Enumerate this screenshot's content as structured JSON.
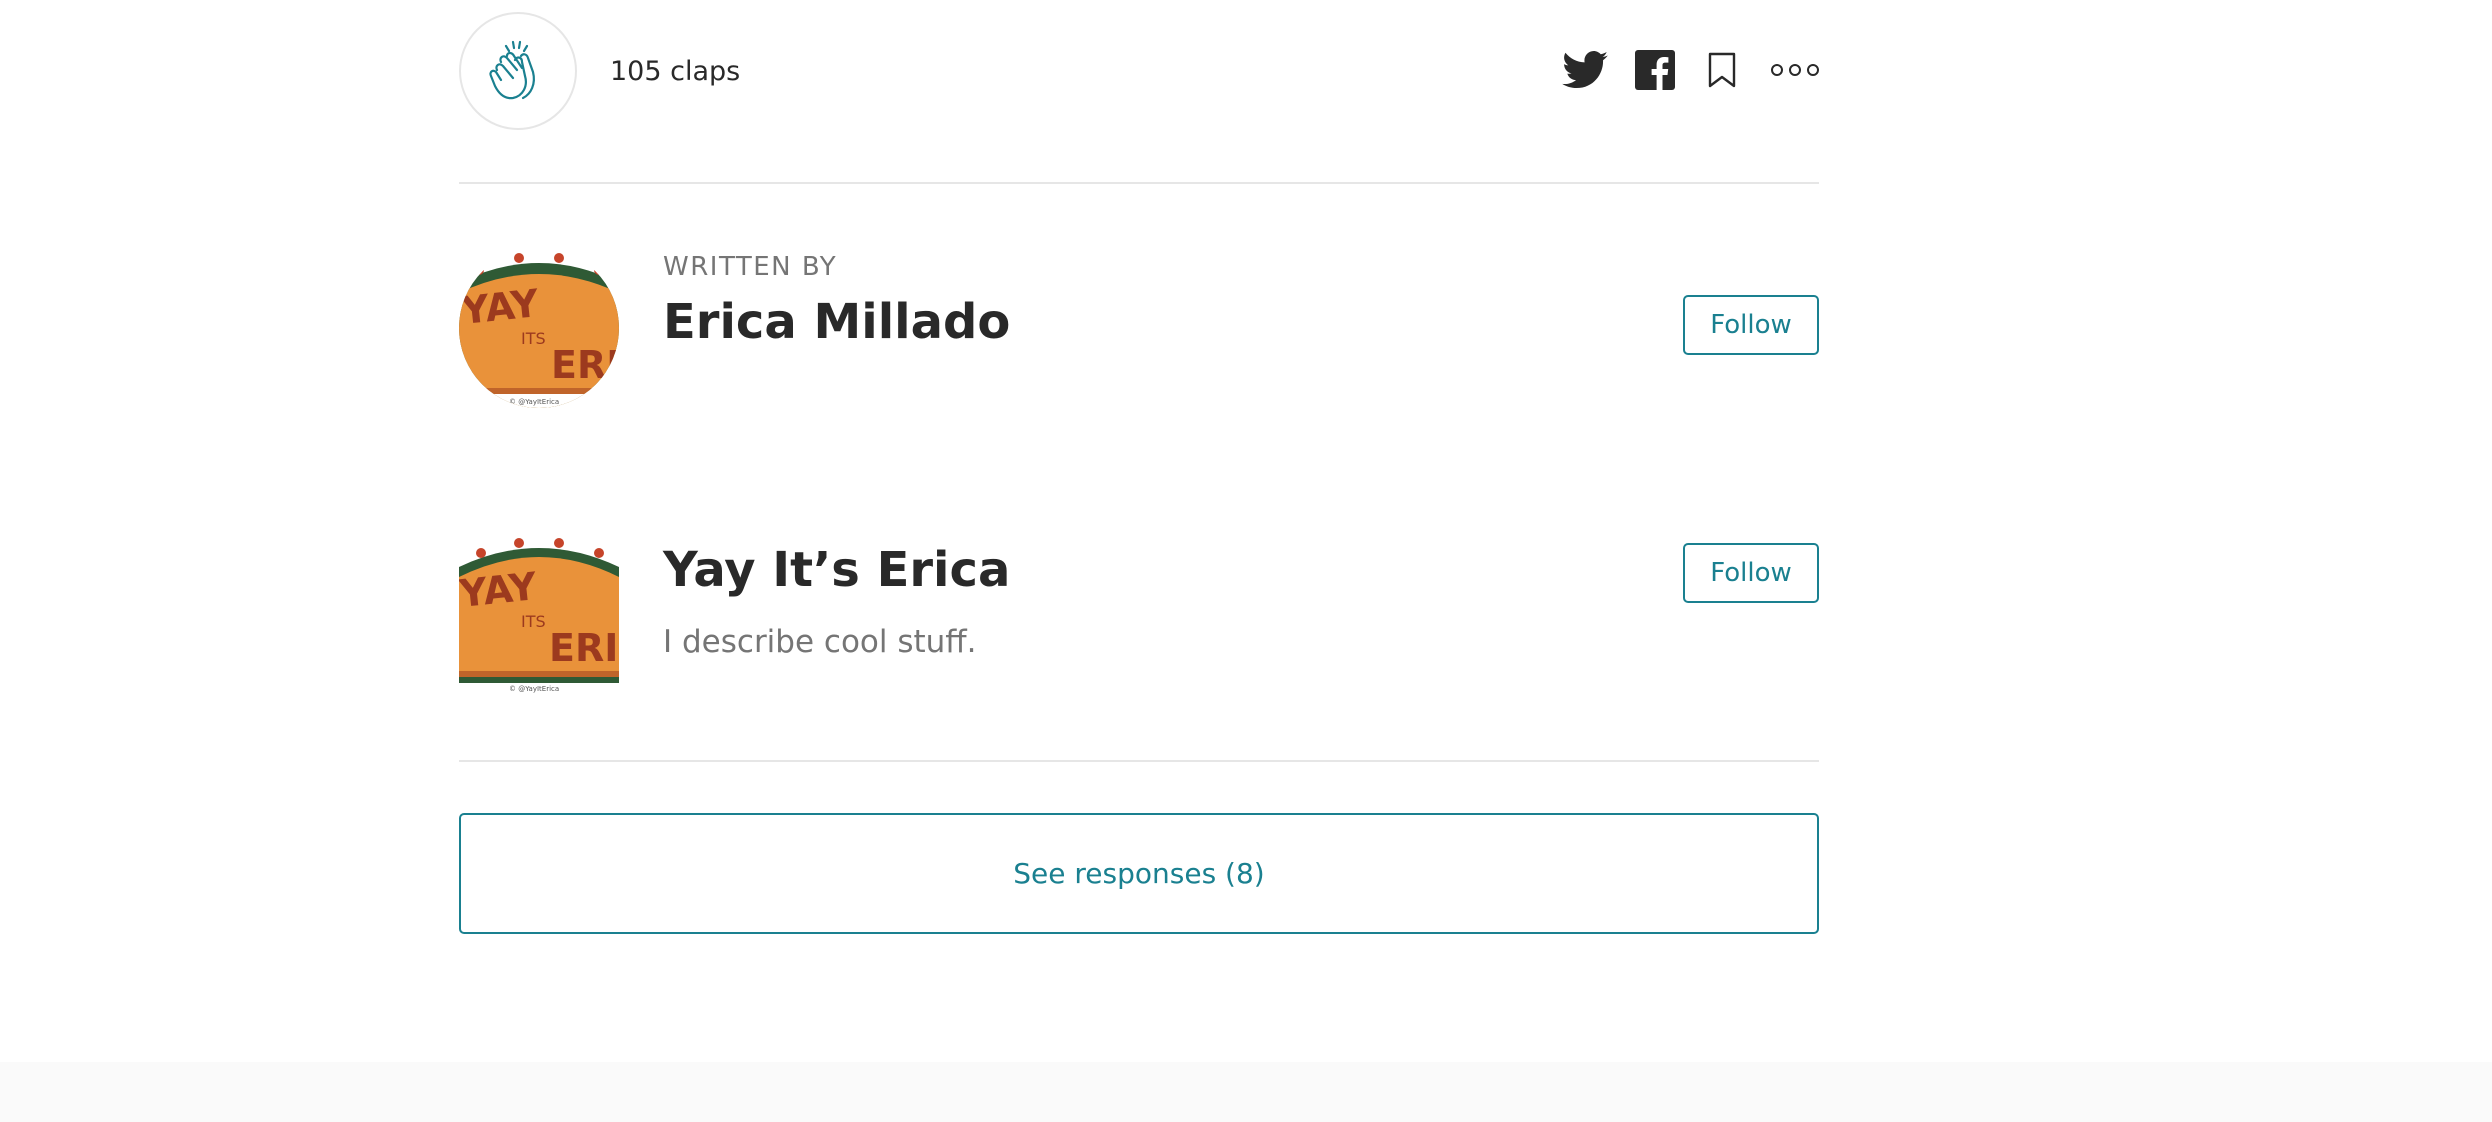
{
  "colors": {
    "accent": "#1a8090",
    "text": "#292929",
    "muted": "#757575",
    "divider": "#e6e6e6",
    "taco_orange": "#e9923a",
    "taco_lettering": "#9c3a1e",
    "lettuce": "#2f5a35"
  },
  "clap": {
    "icon": "clap-hands-icon",
    "count_label": "105 claps"
  },
  "share": {
    "icons": [
      "twitter-icon",
      "facebook-icon",
      "bookmark-icon",
      "more-options-icon"
    ]
  },
  "author": {
    "written_by_label": "WRITTEN BY",
    "name": "Erica Millado",
    "follow_label": "Follow",
    "avatar_text": {
      "top": "YAY",
      "middle": "ITS",
      "bottom": "ERIC",
      "credit": "© @YayItErica"
    }
  },
  "publication": {
    "name": "Yay It’s Erica",
    "description": "I describe cool stuff.",
    "follow_label": "Follow",
    "logo_text": {
      "top": "YAY",
      "middle": "ITS",
      "bottom": "ERIC",
      "credit": "© @YayItErica"
    }
  },
  "responses": {
    "button_label": "See responses (8)"
  }
}
